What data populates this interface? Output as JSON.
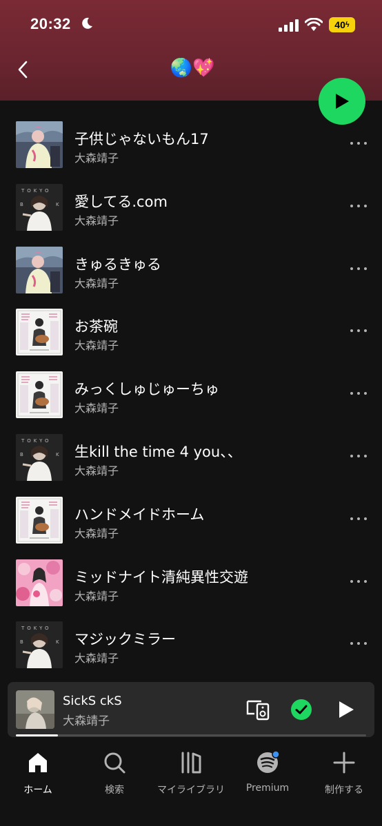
{
  "status_bar": {
    "time": "20:32",
    "battery": "40"
  },
  "header": {
    "title": "🌏💖"
  },
  "tracks": [
    {
      "title": "子供じゃないもん17",
      "artist": "大森靖子",
      "cover": "cover-a"
    },
    {
      "title": "愛してる.com",
      "artist": "大森靖子",
      "cover": "cover-b"
    },
    {
      "title": "きゅるきゅる",
      "artist": "大森靖子",
      "cover": "cover-a"
    },
    {
      "title": "お茶碗",
      "artist": "大森靖子",
      "cover": "cover-c"
    },
    {
      "title": "みっくしゅじゅーちゅ",
      "artist": "大森靖子",
      "cover": "cover-c"
    },
    {
      "title": "生kill the time 4 you、、",
      "artist": "大森靖子",
      "cover": "cover-b"
    },
    {
      "title": "ハンドメイドホーム",
      "artist": "大森靖子",
      "cover": "cover-c"
    },
    {
      "title": "ミッドナイト清純異性交遊",
      "artist": "大森靖子",
      "cover": "cover-d"
    },
    {
      "title": "マジックミラー",
      "artist": "大森靖子",
      "cover": "cover-b"
    }
  ],
  "now_playing": {
    "title": "SickS ckS",
    "artist": "大森靖子",
    "progress": 0.12
  },
  "nav": [
    {
      "label": "ホーム",
      "icon": "home-icon",
      "active": true
    },
    {
      "label": "検索",
      "icon": "search-icon",
      "active": false
    },
    {
      "label": "マイライブラリ",
      "icon": "library-icon",
      "active": false
    },
    {
      "label": "Premium",
      "icon": "spotify-icon",
      "active": false
    },
    {
      "label": "制作する",
      "icon": "plus-icon",
      "active": false
    }
  ],
  "colors": {
    "accent": "#1ed760",
    "header": "#7a2a34",
    "background": "#121212",
    "notification": "#3d91f4"
  }
}
